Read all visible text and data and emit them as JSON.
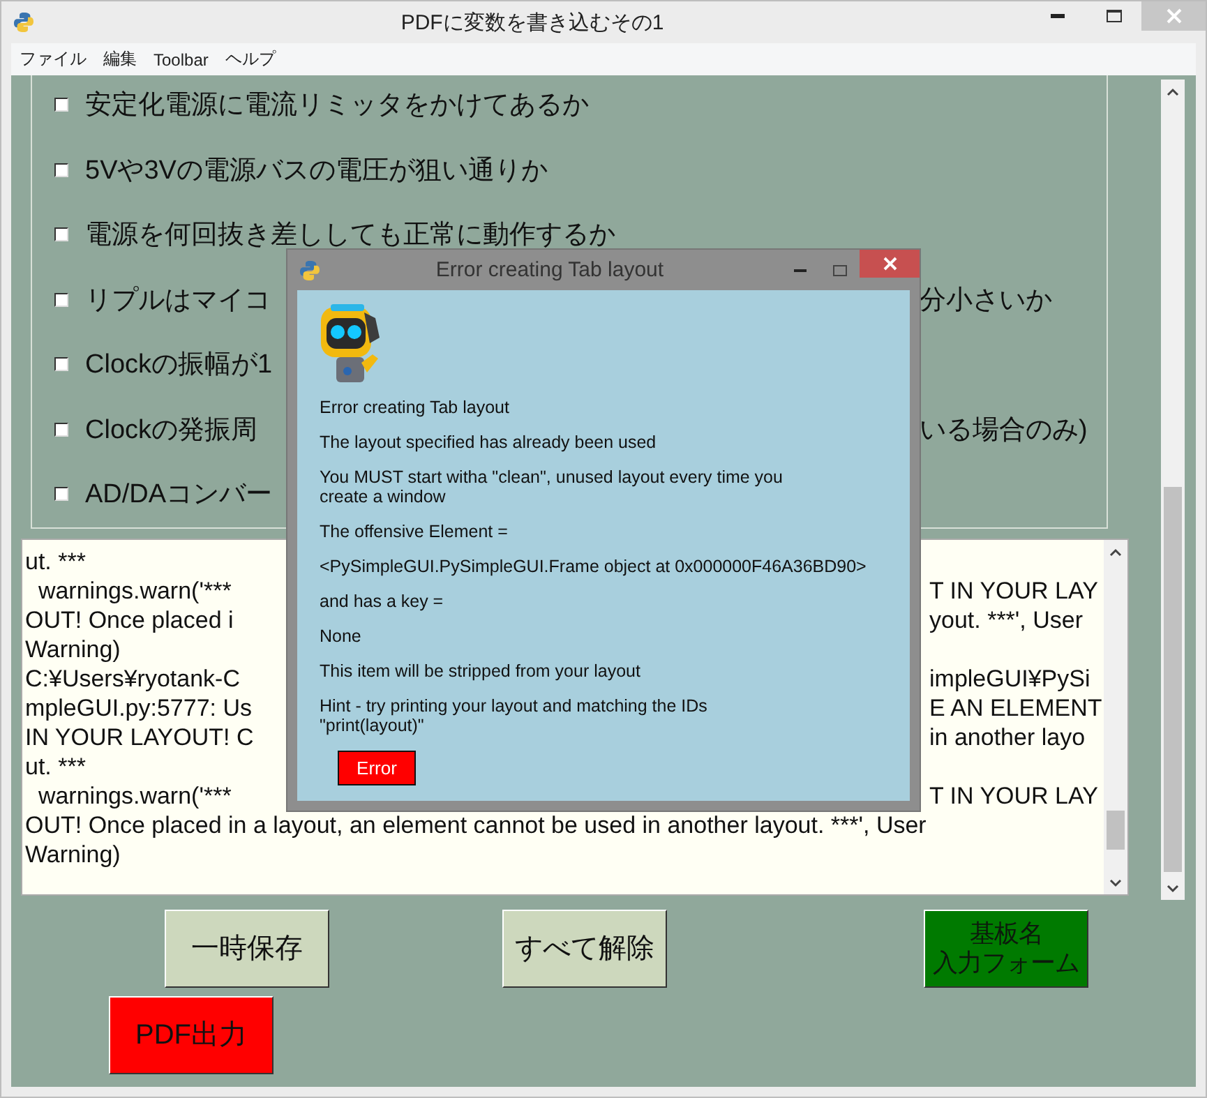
{
  "window": {
    "title": "PDFに変数を書き込むその1"
  },
  "menu": [
    "ファイル",
    "編集",
    "Toolbar",
    "ヘルプ"
  ],
  "checklist": [
    {
      "text": "安定化電源に電流リミッタをかけてあるか",
      "checked": false
    },
    {
      "text": "5Vや3Vの電源バスの電圧が狙い通りか",
      "checked": false
    },
    {
      "text": "電源を何回抜き差ししても正常に動作するか",
      "checked": false
    },
    {
      "text": "リプルはマイコ",
      "text_right": "分小さいか",
      "checked": false
    },
    {
      "text": "Clockの振幅が1",
      "checked": false
    },
    {
      "text": "Clockの発振周",
      "text_right": "いる場合のみ)",
      "checked": false
    },
    {
      "text": "AD/DAコンバー",
      "checked": false
    }
  ],
  "output_log": {
    "lines": [
      {
        "text": "ut. ***"
      },
      {
        "text": "  warnings.warn('***",
        "text_right": "T IN YOUR LAY"
      },
      {
        "text": "OUT! Once placed i",
        "text_right": "yout. ***', User"
      },
      {
        "text": "Warning)"
      },
      {
        "text": "C:¥Users¥ryotank-C",
        "text_right": "impleGUI¥PySi"
      },
      {
        "text": "mpleGUI.py:5777: Us",
        "text_right": "E AN ELEMENT"
      },
      {
        "text": "IN YOUR LAYOUT! C",
        "text_right": "in another layo"
      },
      {
        "text": "ut. ***"
      },
      {
        "text": "  warnings.warn('***",
        "text_right": "T IN YOUR LAY"
      },
      {
        "text": "OUT! Once placed in a layout, an element cannot be used in another layout. ***', User"
      },
      {
        "text": "Warning)"
      }
    ]
  },
  "buttons": [
    {
      "label": "一時保存",
      "kind": "default"
    },
    {
      "label": "すべて解除",
      "kind": "default"
    },
    {
      "label_lines": [
        "基板名",
        "入力フォーム"
      ],
      "kind": "green"
    },
    {
      "label": "PDF出力",
      "kind": "red"
    }
  ],
  "dialog": {
    "title": "Error creating Tab layout",
    "messages": [
      "Error creating Tab layout",
      "The layout specified has already been used",
      "You MUST start witha \"clean\", unused layout every time you\ncreate a window",
      "The offensive Element =",
      "<PySimpleGUI.PySimpleGUI.Frame object at 0x000000F46A36BD90>",
      "and has a key =",
      "None",
      "This item will be stripped from your layout",
      "Hint - try printing your layout and matching the IDs\n\"print(layout)\""
    ],
    "button": "Error"
  }
}
